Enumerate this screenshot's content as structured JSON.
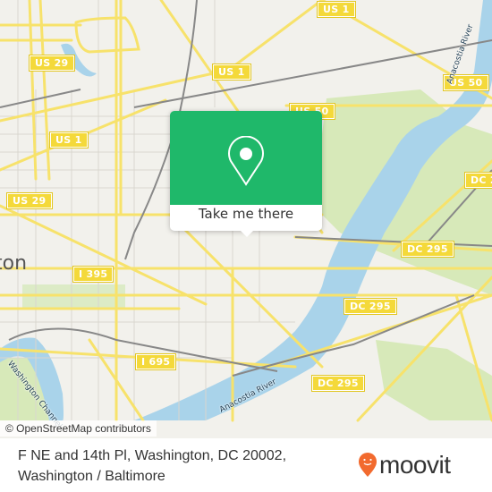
{
  "map": {
    "road_shields": [
      {
        "label": "US 1",
        "id": "us1-top"
      },
      {
        "label": "US 29",
        "id": "us29-top"
      },
      {
        "label": "US 1",
        "id": "us1-mid"
      },
      {
        "label": "US 1",
        "id": "us1-left"
      },
      {
        "label": "US 50",
        "id": "us50-right"
      },
      {
        "label": "US 50",
        "id": "us50-center"
      },
      {
        "label": "US 29",
        "id": "us29-left"
      },
      {
        "label": "DC 2",
        "id": "dc2-right"
      },
      {
        "label": "DC 295",
        "id": "dc295-center"
      },
      {
        "label": "DC 295",
        "id": "dc295-mid"
      },
      {
        "label": "DC 295",
        "id": "dc295-bottom"
      },
      {
        "label": "I 395",
        "id": "i395"
      },
      {
        "label": "I 695",
        "id": "i695"
      }
    ],
    "water_labels": {
      "anacostia_upper": "Anacostia River",
      "anacostia_lower": "Anacostia River",
      "washington_channel": "Washington Channel"
    },
    "city_label": "ton",
    "colors": {
      "land": "#f2f1ec",
      "road": "#f7e26b",
      "water": "#a9d3ea",
      "park": "#d7e9b9",
      "rail": "#888888"
    }
  },
  "popup": {
    "cta_label": "Take me there",
    "icon": "map-pin-icon",
    "color": "#1fb86a"
  },
  "attribution": "© OpenStreetMap contributors",
  "footer": {
    "address_line1": "F NE and 14th Pl, Washington, DC 20002,",
    "address_line2": "Washington / Baltimore",
    "brand": "moovit",
    "brand_color": "#f26a2e"
  }
}
